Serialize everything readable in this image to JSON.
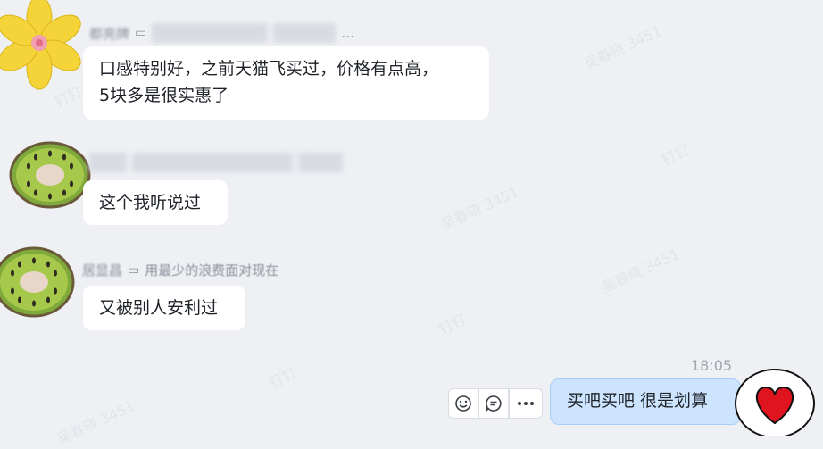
{
  "watermark_text": "吴春晓 3451",
  "watermark_brand": "钉钉",
  "messages": [
    {
      "sender_name": "都亮牌",
      "sender_status": "…",
      "text_line1": "口感特别好，之前天猫飞买过，价格有点高，",
      "text_line2": "5块多是很实惠了"
    },
    {
      "sender_name": "吴显昌",
      "sender_status": "用最少的浪费面对现在",
      "text": "这个我听说过"
    },
    {
      "sender_name": "居显昌",
      "sender_status": "用最少的浪费面对现在",
      "text": "又被别人安利过"
    }
  ],
  "outgoing": {
    "time": "18:05",
    "text": "买吧买吧 很是划算"
  },
  "actions": {
    "emoji": "emoji-icon",
    "reply": "reply-icon",
    "more": "more-icon"
  },
  "colors": {
    "background": "#eef0f4",
    "outgoing_bubble": "#cde4ff",
    "heart": "#e0141e"
  }
}
